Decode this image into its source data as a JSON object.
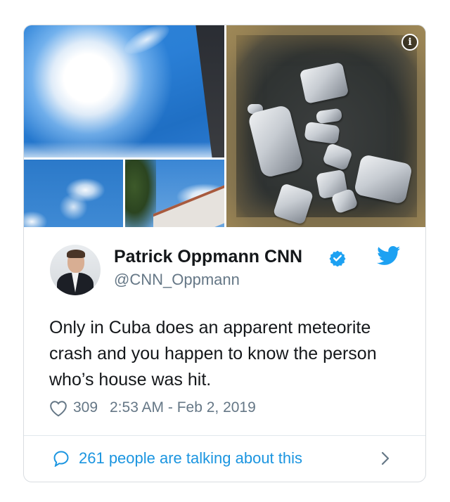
{
  "tweet": {
    "display_name": "Patrick Oppmann CNN",
    "handle": "@CNN_Oppmann",
    "text": "Only in Cuba does an apparent meteorite crash and you happen to know the person who’s house was hit.",
    "likes": "309",
    "timestamp": "2:53 AM - Feb 2, 2019",
    "conversation": "261 people are talking about this",
    "info_glyph": "i"
  },
  "colors": {
    "accent": "#1b95e0",
    "verified": "#1da1f2",
    "secondary_text": "#657786",
    "primary_text": "#14171a",
    "border": "#d9dde1"
  },
  "icons": [
    "info-icon",
    "verified-badge-icon",
    "twitter-bird-icon",
    "heart-icon",
    "speech-bubble-icon",
    "chevron-right-icon"
  ]
}
